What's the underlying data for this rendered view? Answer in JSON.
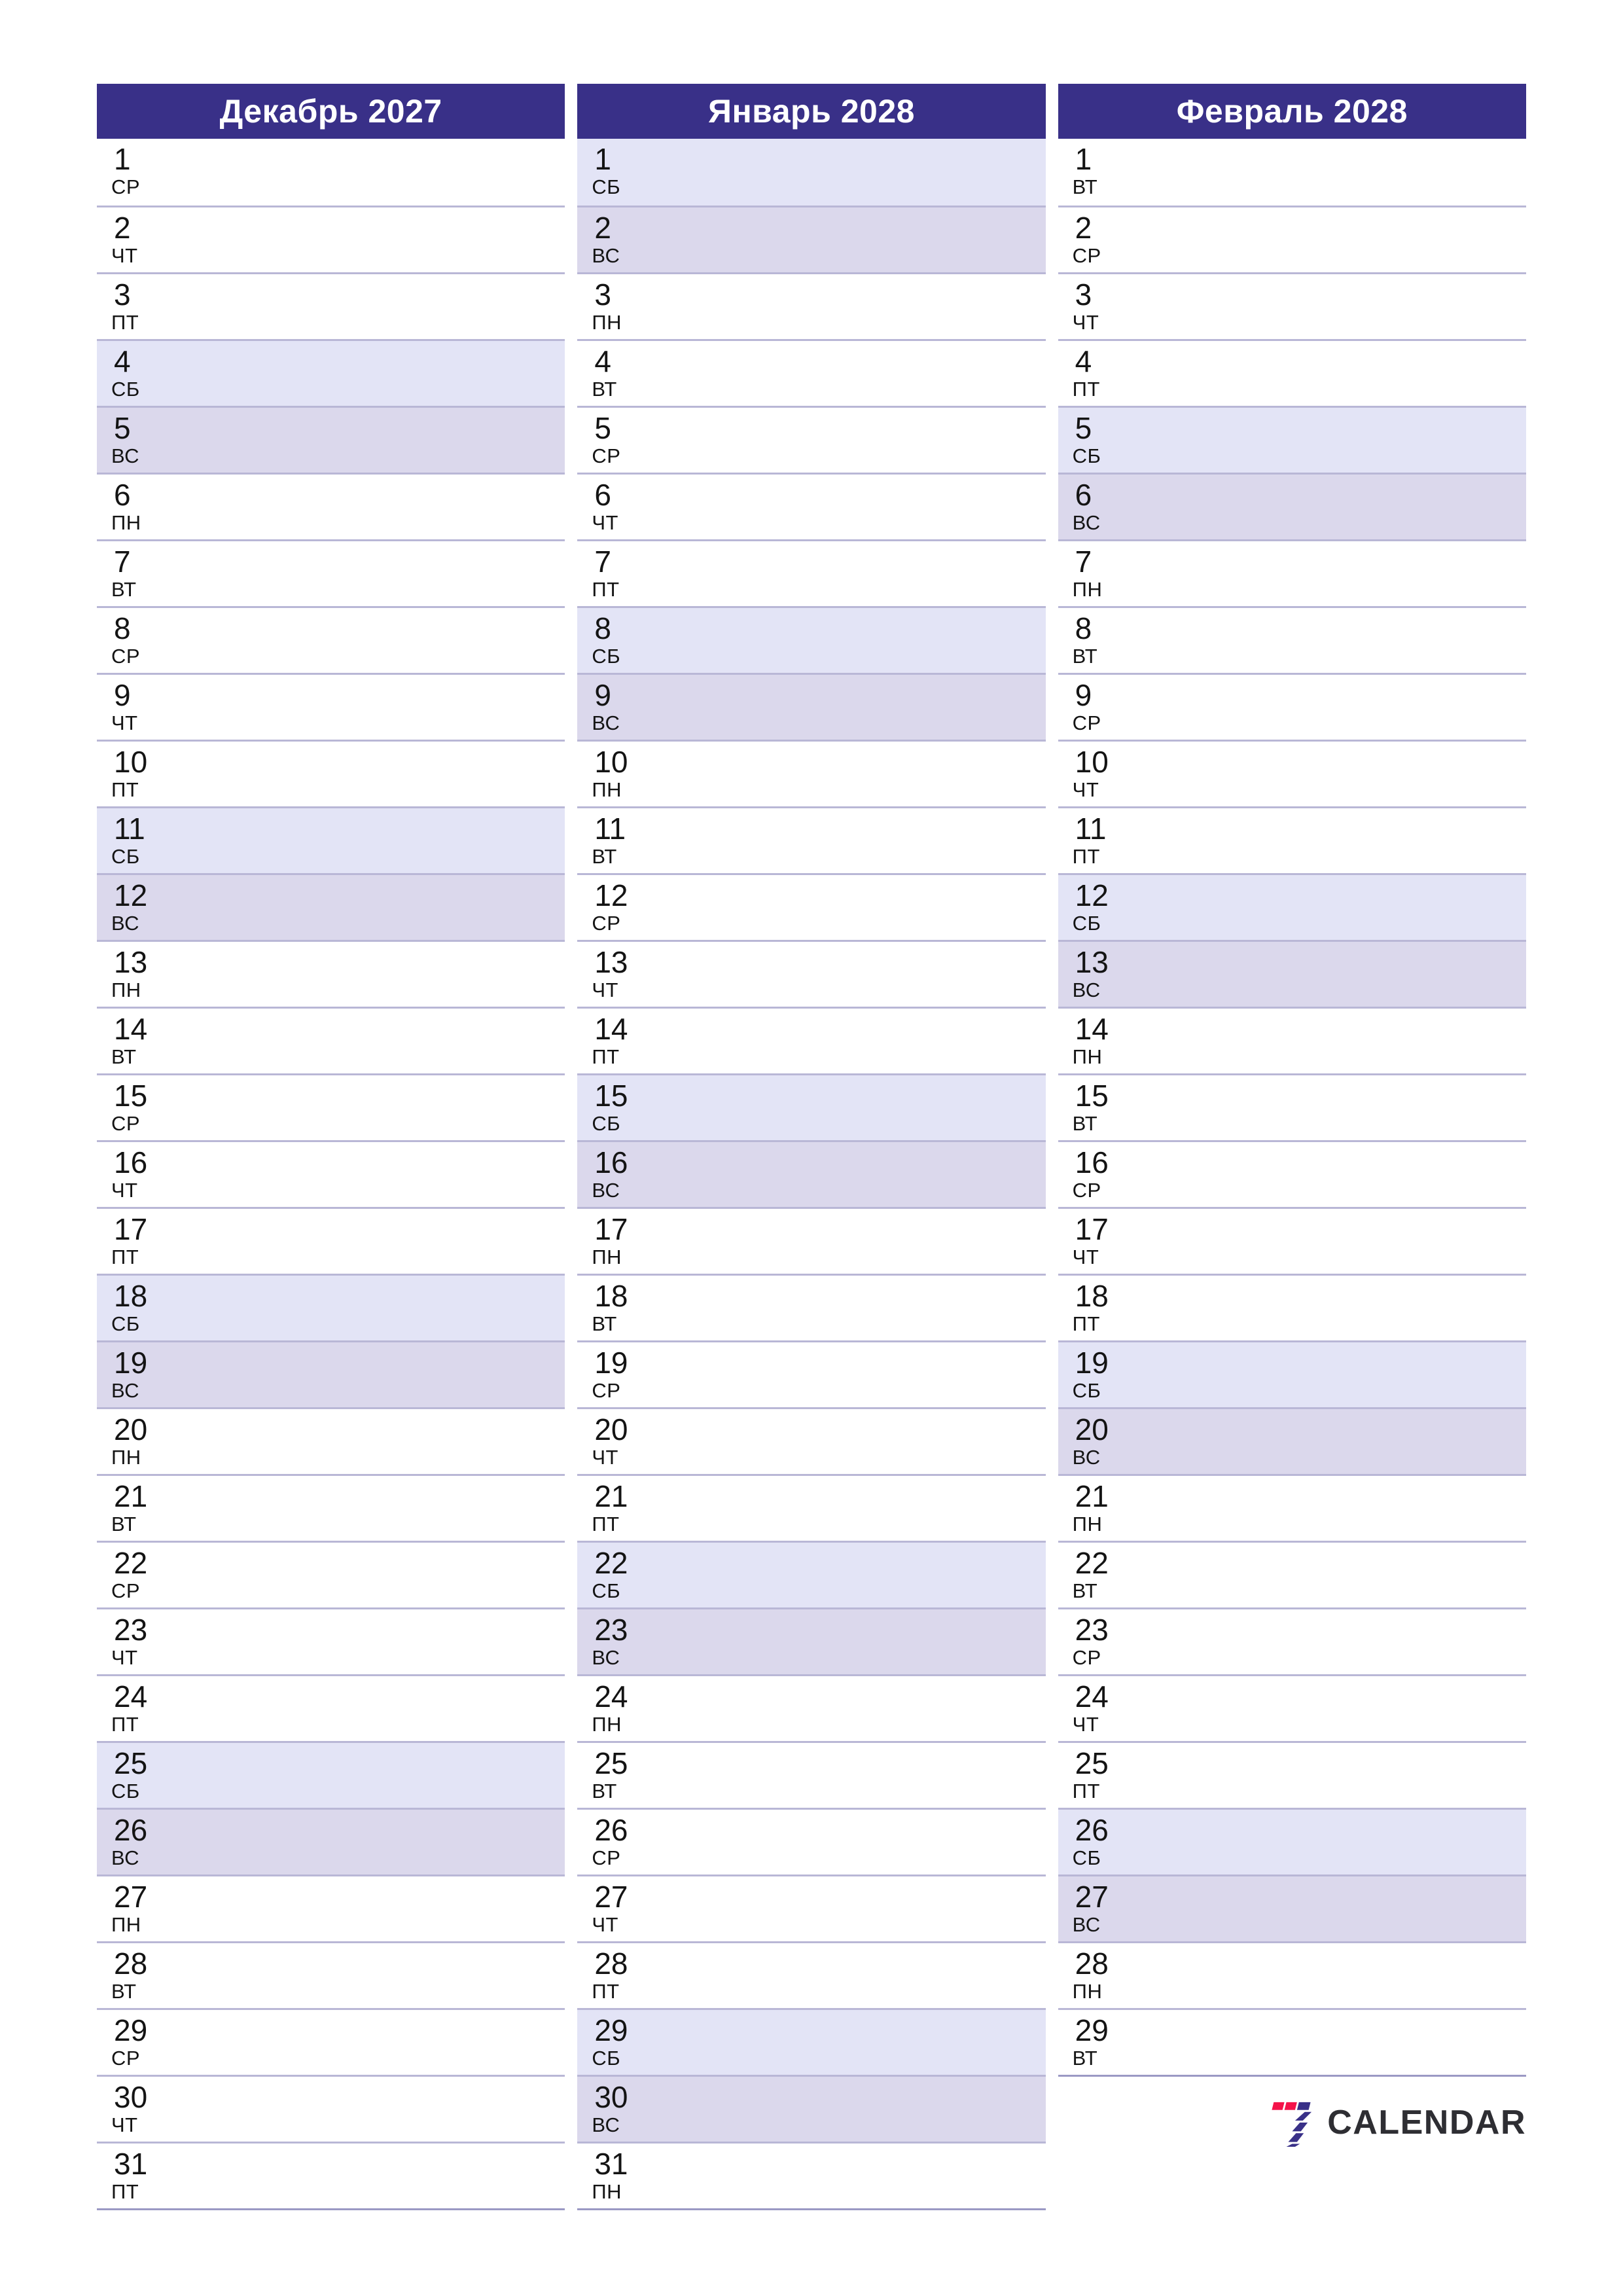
{
  "page": {
    "orientation": "portrait",
    "layout": "three-month-vertical-planner",
    "accent_color": "#393088",
    "saturday_color": "#e3e4f6",
    "sunday_color": "#dbd8ec",
    "grid_line_color": "#b9b7d6"
  },
  "brand": {
    "word": "CALENDAR",
    "mark_name": "seven-logo",
    "mark_colors": [
      "#f4134a",
      "#393088"
    ],
    "word_color": "#2e2e33"
  },
  "months": [
    {
      "title": "Декабрь 2027",
      "days": [
        {
          "num": "1",
          "dow": "СР"
        },
        {
          "num": "2",
          "dow": "ЧТ"
        },
        {
          "num": "3",
          "dow": "ПТ"
        },
        {
          "num": "4",
          "dow": "СБ"
        },
        {
          "num": "5",
          "dow": "ВС"
        },
        {
          "num": "6",
          "dow": "ПН"
        },
        {
          "num": "7",
          "dow": "ВТ"
        },
        {
          "num": "8",
          "dow": "СР"
        },
        {
          "num": "9",
          "dow": "ЧТ"
        },
        {
          "num": "10",
          "dow": "ПТ"
        },
        {
          "num": "11",
          "dow": "СБ"
        },
        {
          "num": "12",
          "dow": "ВС"
        },
        {
          "num": "13",
          "dow": "ПН"
        },
        {
          "num": "14",
          "dow": "ВТ"
        },
        {
          "num": "15",
          "dow": "СР"
        },
        {
          "num": "16",
          "dow": "ЧТ"
        },
        {
          "num": "17",
          "dow": "ПТ"
        },
        {
          "num": "18",
          "dow": "СБ"
        },
        {
          "num": "19",
          "dow": "ВС"
        },
        {
          "num": "20",
          "dow": "ПН"
        },
        {
          "num": "21",
          "dow": "ВТ"
        },
        {
          "num": "22",
          "dow": "СР"
        },
        {
          "num": "23",
          "dow": "ЧТ"
        },
        {
          "num": "24",
          "dow": "ПТ"
        },
        {
          "num": "25",
          "dow": "СБ"
        },
        {
          "num": "26",
          "dow": "ВС"
        },
        {
          "num": "27",
          "dow": "ПН"
        },
        {
          "num": "28",
          "dow": "ВТ"
        },
        {
          "num": "29",
          "dow": "СР"
        },
        {
          "num": "30",
          "dow": "ЧТ"
        },
        {
          "num": "31",
          "dow": "ПТ"
        }
      ]
    },
    {
      "title": "Январь 2028",
      "days": [
        {
          "num": "1",
          "dow": "СБ"
        },
        {
          "num": "2",
          "dow": "ВС"
        },
        {
          "num": "3",
          "dow": "ПН"
        },
        {
          "num": "4",
          "dow": "ВТ"
        },
        {
          "num": "5",
          "dow": "СР"
        },
        {
          "num": "6",
          "dow": "ЧТ"
        },
        {
          "num": "7",
          "dow": "ПТ"
        },
        {
          "num": "8",
          "dow": "СБ"
        },
        {
          "num": "9",
          "dow": "ВС"
        },
        {
          "num": "10",
          "dow": "ПН"
        },
        {
          "num": "11",
          "dow": "ВТ"
        },
        {
          "num": "12",
          "dow": "СР"
        },
        {
          "num": "13",
          "dow": "ЧТ"
        },
        {
          "num": "14",
          "dow": "ПТ"
        },
        {
          "num": "15",
          "dow": "СБ"
        },
        {
          "num": "16",
          "dow": "ВС"
        },
        {
          "num": "17",
          "dow": "ПН"
        },
        {
          "num": "18",
          "dow": "ВТ"
        },
        {
          "num": "19",
          "dow": "СР"
        },
        {
          "num": "20",
          "dow": "ЧТ"
        },
        {
          "num": "21",
          "dow": "ПТ"
        },
        {
          "num": "22",
          "dow": "СБ"
        },
        {
          "num": "23",
          "dow": "ВС"
        },
        {
          "num": "24",
          "dow": "ПН"
        },
        {
          "num": "25",
          "dow": "ВТ"
        },
        {
          "num": "26",
          "dow": "СР"
        },
        {
          "num": "27",
          "dow": "ЧТ"
        },
        {
          "num": "28",
          "dow": "ПТ"
        },
        {
          "num": "29",
          "dow": "СБ"
        },
        {
          "num": "30",
          "dow": "ВС"
        },
        {
          "num": "31",
          "dow": "ПН"
        }
      ]
    },
    {
      "title": "Февраль 2028",
      "days": [
        {
          "num": "1",
          "dow": "ВТ"
        },
        {
          "num": "2",
          "dow": "СР"
        },
        {
          "num": "3",
          "dow": "ЧТ"
        },
        {
          "num": "4",
          "dow": "ПТ"
        },
        {
          "num": "5",
          "dow": "СБ"
        },
        {
          "num": "6",
          "dow": "ВС"
        },
        {
          "num": "7",
          "dow": "ПН"
        },
        {
          "num": "8",
          "dow": "ВТ"
        },
        {
          "num": "9",
          "dow": "СР"
        },
        {
          "num": "10",
          "dow": "ЧТ"
        },
        {
          "num": "11",
          "dow": "ПТ"
        },
        {
          "num": "12",
          "dow": "СБ"
        },
        {
          "num": "13",
          "dow": "ВС"
        },
        {
          "num": "14",
          "dow": "ПН"
        },
        {
          "num": "15",
          "dow": "ВТ"
        },
        {
          "num": "16",
          "dow": "СР"
        },
        {
          "num": "17",
          "dow": "ЧТ"
        },
        {
          "num": "18",
          "dow": "ПТ"
        },
        {
          "num": "19",
          "dow": "СБ"
        },
        {
          "num": "20",
          "dow": "ВС"
        },
        {
          "num": "21",
          "dow": "ПН"
        },
        {
          "num": "22",
          "dow": "ВТ"
        },
        {
          "num": "23",
          "dow": "СР"
        },
        {
          "num": "24",
          "dow": "ЧТ"
        },
        {
          "num": "25",
          "dow": "ПТ"
        },
        {
          "num": "26",
          "dow": "СБ"
        },
        {
          "num": "27",
          "dow": "ВС"
        },
        {
          "num": "28",
          "dow": "ПН"
        },
        {
          "num": "29",
          "dow": "ВТ"
        }
      ]
    }
  ]
}
